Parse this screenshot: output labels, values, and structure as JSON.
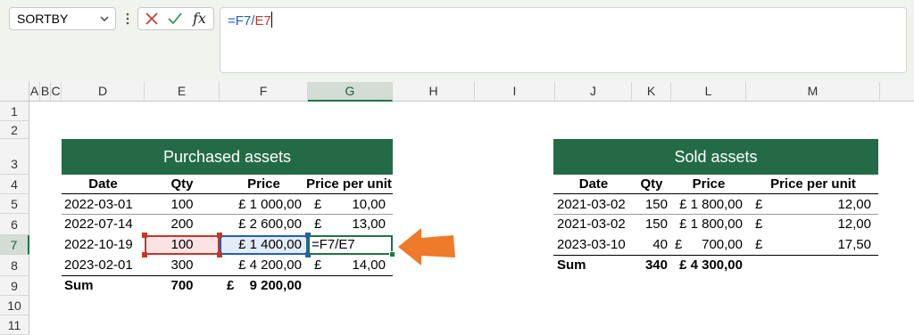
{
  "formula_bar": {
    "name_box": "SORTBY",
    "formula_prefix": "=F7/",
    "formula_ref": "E7",
    "formula_prefix_color": "#1f5fbf",
    "formula_ref_color": "#c0392b"
  },
  "columns": [
    "A",
    "B",
    "C",
    "D",
    "E",
    "F",
    "G",
    "H",
    "I",
    "J",
    "K",
    "L",
    "M"
  ],
  "rows": [
    "1",
    "2",
    "3",
    "4",
    "5",
    "6",
    "7",
    "8",
    "9",
    "10",
    "11"
  ],
  "selected_column": "G",
  "selected_row": "7",
  "purchased": {
    "title": "Purchased assets",
    "headers": [
      "Date",
      "Qty",
      "Price",
      "Price per unit"
    ],
    "rows": [
      {
        "date": "2022-03-01",
        "qty": "100",
        "price": "£ 1 000,00",
        "ppu_sym": "£",
        "ppu": "10,00"
      },
      {
        "date": "2022-07-14",
        "qty": "200",
        "price": "£ 2 600,00",
        "ppu_sym": "£",
        "ppu": "13,00"
      },
      {
        "date": "2022-10-19",
        "qty": "100",
        "price": "£ 1 400,00",
        "ppu_sym": "",
        "ppu": "=F7/E7"
      },
      {
        "date": "2023-02-01",
        "qty": "300",
        "price": "£ 4 200,00",
        "ppu_sym": "£",
        "ppu": "14,00"
      }
    ],
    "sum_label": "Sum",
    "sum_qty": "700",
    "sum_price_sym": "£",
    "sum_price": "9 200,00"
  },
  "sold": {
    "title": "Sold assets",
    "headers": [
      "Date",
      "Qty",
      "Price",
      "Price per unit"
    ],
    "rows": [
      {
        "date": "2021-03-02",
        "qty": "150",
        "price": "£ 1 800,00",
        "ppu_sym": "£",
        "ppu": "12,00"
      },
      {
        "date": "2021-03-02",
        "qty": "150",
        "price": "£ 1 800,00",
        "ppu_sym": "£",
        "ppu": "12,00"
      },
      {
        "date": "2023-03-10",
        "qty": "40",
        "price_sym": "£",
        "price": "700,00",
        "ppu_sym": "£",
        "ppu": "17,50"
      }
    ],
    "sum_label": "Sum",
    "sum_qty": "340",
    "sum_price": "£ 4 300,00"
  },
  "colors": {
    "title_bg": "#236b47",
    "qty_ref_fill": "#fbe3e3",
    "qty_ref_border": "#c0392b",
    "price_ref_fill": "#e3ecf9",
    "price_ref_border": "#1f5fbf",
    "active_border": "#217346",
    "arrow": "#ee7a2a"
  },
  "icons": [
    "chevron-down-icon",
    "more-icon",
    "cancel-icon",
    "confirm-icon",
    "function-icon",
    "arrow-left-icon"
  ]
}
